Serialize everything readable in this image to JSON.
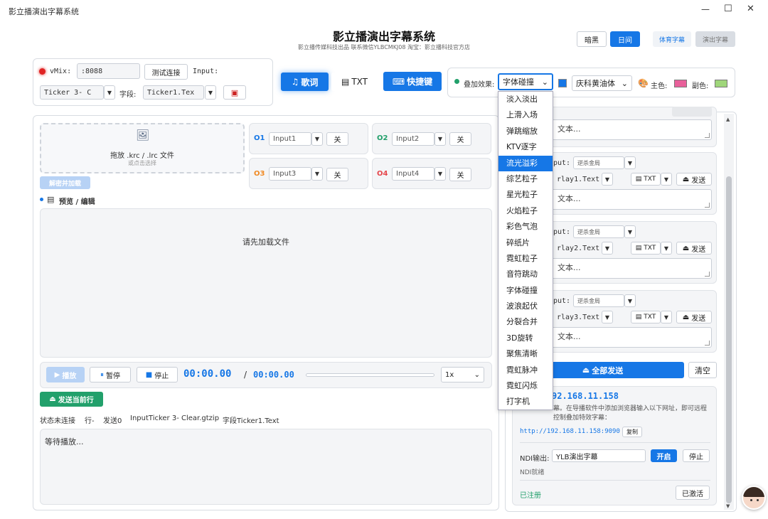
{
  "window": {
    "title": "影立播演出字幕系统",
    "minimize": "—",
    "maximize": "☐",
    "close": "✕"
  },
  "header": {
    "title": "影立播演出字幕系统",
    "subtitle": "影立播传媒科技出品 联系微信YLBCMKJ08 淘宝：影立播科技官方店",
    "theme_dark": "暗黑",
    "theme_day": "日间",
    "sports_subtitle": "体育字幕",
    "show_subtitle": "演出字幕"
  },
  "vmix": {
    "label": "vMix:",
    "port": ":8088",
    "test_button": "测试连接",
    "input_label": "Input:",
    "ticker_select": "Ticker 3- C",
    "field_label": "字段:",
    "field_select": "Ticker1.Tex"
  },
  "modes": {
    "lyrics": "歌词",
    "txt": "TXT",
    "hotkeys": "快捷键"
  },
  "effects": {
    "label": "叠加效果:",
    "current": "字体碰撞",
    "font": "庆科黄油体",
    "primary_label": "主色:",
    "secondary_label": "副色:",
    "primary_color": "#e8609a",
    "secondary_color": "#9fd67a"
  },
  "dropdown": [
    "淡入淡出",
    "上滑入场",
    "弹跳缩放",
    "KTV逐字",
    "流光溢彩",
    "综艺粒子",
    "星光粒子",
    "火焰粒子",
    "彩色气泡",
    "碎纸片",
    "霓虹粒子",
    "音符跳动",
    "字体碰撞",
    "波浪起伏",
    "分裂合并",
    "3D旋转",
    "聚焦清晰",
    "霓虹脉冲",
    "霓虹闪烁",
    "打字机"
  ],
  "dropdown_selected_index": 4,
  "upload": {
    "title": "拖放 .krc / .lrc 文件",
    "hint": "或点击选择",
    "decrypt": "解密并加载"
  },
  "outputs": [
    {
      "id": "O1",
      "input": "Input1",
      "off": "关",
      "color": "#1677e6"
    },
    {
      "id": "O2",
      "input": "Input2",
      "off": "关",
      "color": "#22a06b"
    },
    {
      "id": "O3",
      "input": "Input3",
      "off": "关",
      "color": "#f08a24"
    },
    {
      "id": "O4",
      "input": "Input4",
      "off": "关",
      "color": "#e5484d"
    }
  ],
  "preview": {
    "label": "预览 / 编辑",
    "empty": "请先加载文件"
  },
  "player": {
    "play": "播放",
    "pause": "暂停",
    "stop": "停止",
    "current": "00:00.00",
    "sep": "/",
    "total": "00:00.00",
    "speed": "1x"
  },
  "send_current": "发送当前行",
  "status": {
    "state": "状态未连接",
    "line": "行-",
    "sent": "发送0",
    "input": "InputTicker 3- Clear.gtzip",
    "field": "字段Ticker1.Text"
  },
  "log": "等待播放...",
  "right": {
    "text_placeholder": "文本...",
    "rows": [
      {
        "input_label": "put:",
        "input_value": "逆杀金局",
        "field": "rlay1.Text",
        "txt": "TXT",
        "send": "发送"
      },
      {
        "input_label": "put:",
        "input_value": "逆杀金局",
        "field": "rlay2.Text",
        "txt": "TXT",
        "send": "发送"
      },
      {
        "input_label": "put:",
        "input_value": "逆杀金局",
        "field": "rlay3.Text",
        "txt": "TXT",
        "send": "发送"
      }
    ],
    "send_all": "全部发送",
    "clear": "清空",
    "ip": "92.168.11.158",
    "remote_desc": "幕。在导播软件中添加浏览器输入以下网址，即可远程控制叠加特效字幕：",
    "url": "http://192.168.11.158:9090",
    "copy": "复制",
    "ndi_label": "NDI输出:",
    "ndi_name": "YLB演出字幕",
    "ndi_start": "开启",
    "ndi_stop": "停止",
    "ndi_status": "NDI就绪",
    "registered": "已注册",
    "activated": "已激活"
  }
}
